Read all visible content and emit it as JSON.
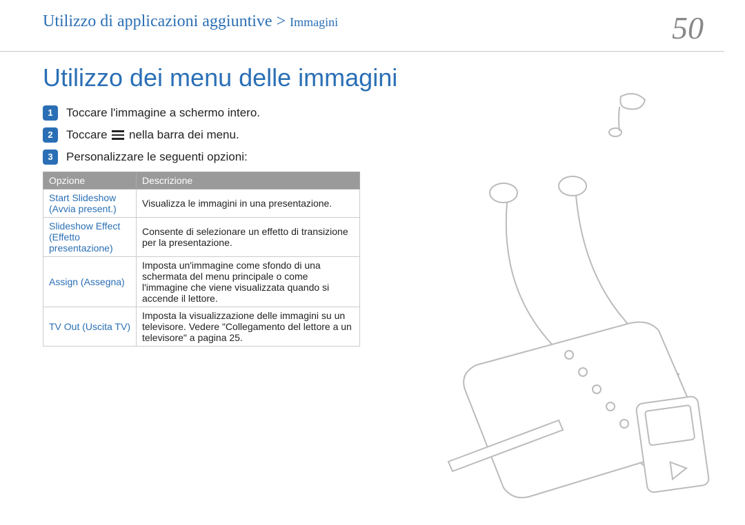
{
  "header": {
    "breadcrumb_main": "Utilizzo di applicazioni aggiuntive > ",
    "breadcrumb_sub": "Immagini",
    "page_number": "50"
  },
  "title": "Utilizzo dei menu delle immagini",
  "steps": [
    {
      "num": "1",
      "before": "Toccare l'immagine a schermo intero.",
      "after": ""
    },
    {
      "num": "2",
      "before": "Toccare ",
      "after": " nella barra dei menu.",
      "has_icon": true
    },
    {
      "num": "3",
      "before": "Personalizzare le seguenti opzioni:",
      "after": ""
    }
  ],
  "table": {
    "headers": {
      "option": "Opzione",
      "description": "Descrizione"
    },
    "rows": [
      {
        "option": "Start Slideshow (Avvia present.)",
        "description": "Visualizza le immagini in una presentazione."
      },
      {
        "option": "Slideshow Effect (Effetto presentazione)",
        "description": "Consente di selezionare un effetto di transizione per la presentazione."
      },
      {
        "option": "Assign (Assegna)",
        "description": "Imposta un'immagine come sfondo di una schermata del menu principale o come l'immagine che viene visualizzata quando si accende il lettore."
      },
      {
        "option": "TV Out (Uscita TV)",
        "description": "Imposta la visualizzazione delle immagini su un televisore. Vedere \"Collegamento del lettore a un televisore\" a pagina 25."
      }
    ]
  }
}
